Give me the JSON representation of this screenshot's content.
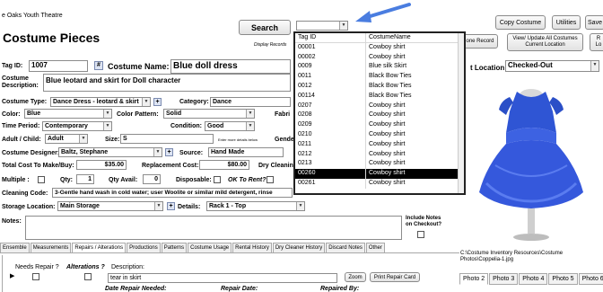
{
  "org_title": "e Oaks Youth Theatre",
  "form_title": "Costume Pieces",
  "search_label": "Search",
  "display_records_label": "Display Records",
  "top_buttons": {
    "copy_costume": "Copy Costume",
    "utilities": "Utilities",
    "save": "Save",
    "clone_record": "one Record",
    "view_update_line1": "View/ Update All Costumes",
    "view_update_line2": "Current Location",
    "re_line1": "R",
    "re_line2": "Lo"
  },
  "tag_id": {
    "label": "Tag ID:",
    "value": "1007",
    "hash": "#"
  },
  "costume_name": {
    "label": "Costume Name:",
    "value": "Blue doll dress"
  },
  "description": {
    "label_line1": "Costume",
    "label_line2": "Description:",
    "value": "Blue leotard and skirt for Doll character"
  },
  "costume_type": {
    "label": "Costume Type:",
    "value": "Dance Dress - leotard & skirt"
  },
  "category": {
    "label": "Category:",
    "value": "Dance"
  },
  "color": {
    "label": "Color:",
    "value": "Blue"
  },
  "color_pattern": {
    "label": "Color Pattern:",
    "value": "Solid"
  },
  "fabric_label": "Fabri",
  "time_period": {
    "label": "Time Period:",
    "value": "Contemporary"
  },
  "condition": {
    "label": "Condition:",
    "value": "Good"
  },
  "adult_child": {
    "label": "Adult / Child:",
    "value": "Adult"
  },
  "size": {
    "label": "Size:",
    "value": "S",
    "hint": "Enter more details below"
  },
  "gender_label": "Gende",
  "designer": {
    "label": "Costume Designer:",
    "value": "Baltz, Stephane"
  },
  "source": {
    "label": "Source:",
    "value": "Hand Made"
  },
  "total_cost": {
    "label": "Total Cost To Make/Buy:",
    "value": "$35.00"
  },
  "replacement_cost": {
    "label": "Replacement Cost:",
    "value": "$80.00"
  },
  "dry_cleaning_label": "Dry Cleanin",
  "multiple": {
    "label": "Multiple :"
  },
  "qty": {
    "label": "Qty:",
    "value": "1"
  },
  "qty_avail": {
    "label": "Qty Avail:",
    "value": "0"
  },
  "disposable": {
    "label": "Disposable:"
  },
  "ok_to_rent": {
    "label": "OK To Rent?"
  },
  "cleaning_code": {
    "label": "Cleaning Code:",
    "value": "3-Gentle hand wash in cold water; user Woolite or similar mild detergent, rinse"
  },
  "storage": {
    "label": "Storage Location:",
    "value": "Main Storage"
  },
  "details": {
    "label": "Details:",
    "value": "Rack 1 - Top"
  },
  "notes": {
    "label": "Notes:",
    "include_line1": "Include Notes",
    "include_line2": "on Checkout?"
  },
  "location": {
    "label": "t Location:",
    "value": "Checked-Out"
  },
  "tabs": [
    "Ensemble",
    "Measurements",
    "Repairs / Alterations",
    "Productions",
    "Patterns",
    "Costume Usage",
    "Rental History",
    "Dry Cleaner History",
    "Discard Notes",
    "Other"
  ],
  "repairs": {
    "needs_repair": "Needs Repair ?",
    "alterations": "Alterations ?",
    "description_label": "Description:",
    "description_value": "tear in skirt",
    "zoom": "Zoom",
    "print_repair_card": "Print Repair Card",
    "date_repair_needed": "Date Repair Needed:",
    "repair_date": "Repair Date:",
    "repaired_by": "Repaired By:"
  },
  "photo_path": "C:\\Costume Inventory Resources\\Costume Photos\\Coppelia-1.jpg",
  "photo_tabs": [
    "Photo 2",
    "Photo 3",
    "Photo 4",
    "Photo 5",
    "Photo 6"
  ],
  "popup": {
    "header_tag": "Tag ID",
    "header_name": "CostumeName",
    "rows": [
      {
        "id": "00001",
        "name": "Cowboy shirt"
      },
      {
        "id": "00002",
        "name": "Cowboy shirt"
      },
      {
        "id": "0009",
        "name": "Blue silk Skirt"
      },
      {
        "id": "0011",
        "name": "Black Bow Ties"
      },
      {
        "id": "0012",
        "name": "Black Bow Ties"
      },
      {
        "id": "00114",
        "name": "Black Bow Ties"
      },
      {
        "id": "0207",
        "name": "Cowboy shirt"
      },
      {
        "id": "0208",
        "name": "Cowboy shirt"
      },
      {
        "id": "0209",
        "name": "Cowboy shirt"
      },
      {
        "id": "0210",
        "name": "Cowboy shirt"
      },
      {
        "id": "0211",
        "name": "Cowboy shirt"
      },
      {
        "id": "0212",
        "name": "Cowboy shirt"
      },
      {
        "id": "0213",
        "name": "Cowboy shirt"
      },
      {
        "id": "00260",
        "name": "Cowboy shirt"
      },
      {
        "id": "00261",
        "name": "Cowboy shirt"
      }
    ],
    "selected_index": 13
  },
  "colors": {
    "arrow": "#4a7de0",
    "dress": "#2f55d4",
    "selected_row": "#000000"
  }
}
